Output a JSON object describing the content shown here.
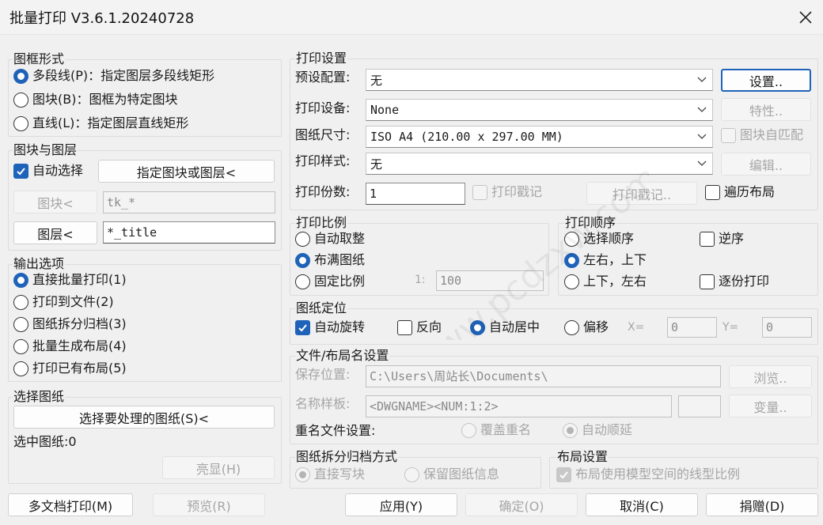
{
  "window": {
    "title": "批量打印 V3.6.1.20240728"
  },
  "frame_shape": {
    "label": "图框形式",
    "options": [
      {
        "label": "多段线(P)：指定图层多段线矩形",
        "selected": true
      },
      {
        "label": "图块(B)：图框为特定图块",
        "selected": false
      },
      {
        "label": "直线(L)：指定图层直线矩形",
        "selected": false
      }
    ]
  },
  "block_layer": {
    "label": "图块与图层",
    "auto_select_label": "自动选择",
    "auto_select_checked": true,
    "pick_button": "指定图块或图层<",
    "block_button": "图块<",
    "block_value": "tk_*",
    "layer_button": "图层<",
    "layer_value": "*_title"
  },
  "output": {
    "label": "输出选项",
    "options": [
      {
        "label": "直接批量打印(1)",
        "selected": true
      },
      {
        "label": "打印到文件(2)",
        "selected": false
      },
      {
        "label": "图纸拆分归档(3)",
        "selected": false
      },
      {
        "label": "批量生成布局(4)",
        "selected": false
      },
      {
        "label": "打印已有布局(5)",
        "selected": false
      }
    ]
  },
  "select_drawings": {
    "label": "选择图纸",
    "select_button": "选择要处理的图纸(S)<",
    "selected_count": "选中图纸:0",
    "highlight_button": "亮显(H)"
  },
  "print_settings": {
    "label": "打印设置",
    "preset_label": "预设配置:",
    "preset_value": "无",
    "setup_button": "设置..",
    "device_label": "打印设备:",
    "device_value": "None",
    "properties_button": "特性..",
    "paper_label": "图纸尺寸:",
    "paper_value": "ISO A4 (210.00 x 297.00 MM)",
    "block_match_label": "图块自匹配",
    "style_label": "打印样式:",
    "style_value": "无",
    "edit_button": "编辑..",
    "copies_label": "打印份数:",
    "copies_value": "1",
    "stamp_label": "打印戳记",
    "stamp_button": "打印戳记..",
    "traverse_label": "遍历布局"
  },
  "scale": {
    "label": "打印比例",
    "options": [
      {
        "label": "自动取整",
        "selected": false
      },
      {
        "label": "布满图纸",
        "selected": true
      },
      {
        "label": "固定比例",
        "selected": false
      }
    ],
    "ratio_prefix": "1:",
    "ratio_value": "100"
  },
  "order": {
    "label": "打印顺序",
    "options": [
      {
        "label": "选择顺序",
        "selected": false
      },
      {
        "label": "左右，上下",
        "selected": true
      },
      {
        "label": "上下，左右",
        "selected": false
      }
    ],
    "reverse_label": "逆序",
    "collate_label": "逐份打印"
  },
  "position": {
    "label": "图纸定位",
    "auto_rotate_label": "自动旋转",
    "reverse_label": "反向",
    "center_label": "自动居中",
    "offset_label": "偏移",
    "x_label": "X=",
    "x_value": "0",
    "y_label": "Y=",
    "y_value": "0"
  },
  "file_naming": {
    "label": "文件/布局名设置",
    "save_label": "保存位置:",
    "save_value": "C:\\Users\\周站长\\Documents\\",
    "browse_button": "浏览..",
    "template_label": "名称样板:",
    "template_value": "<DWGNAME><NUM:1:2>",
    "variable_button": "变量..",
    "dup_label": "重名文件设置:",
    "overwrite_label": "覆盖重名",
    "autoinc_label": "自动顺延"
  },
  "archive": {
    "label": "图纸拆分归档方式",
    "direct_label": "直接写块",
    "keep_label": "保留图纸信息"
  },
  "layout_settings": {
    "label": "布局设置",
    "linetype_label": "布局使用模型空间的线型比例"
  },
  "footer": {
    "multi_doc_button": "多文档打印(M)",
    "preview_button": "预览(R)",
    "apply_button": "应用(Y)",
    "ok_button": "确定(O)",
    "cancel_button": "取消(C)",
    "donate_button": "捐赠(D)"
  },
  "watermark": {
    "text": "www.pcdzxw.com"
  },
  "colors": {
    "accent": "#1f63b9",
    "background": "#f0f0f0",
    "disabled_text": "#a6a6a6"
  },
  "icons": {
    "close": "close-icon",
    "dropdown": "chevron-down-icon",
    "check": "checkmark-icon"
  }
}
